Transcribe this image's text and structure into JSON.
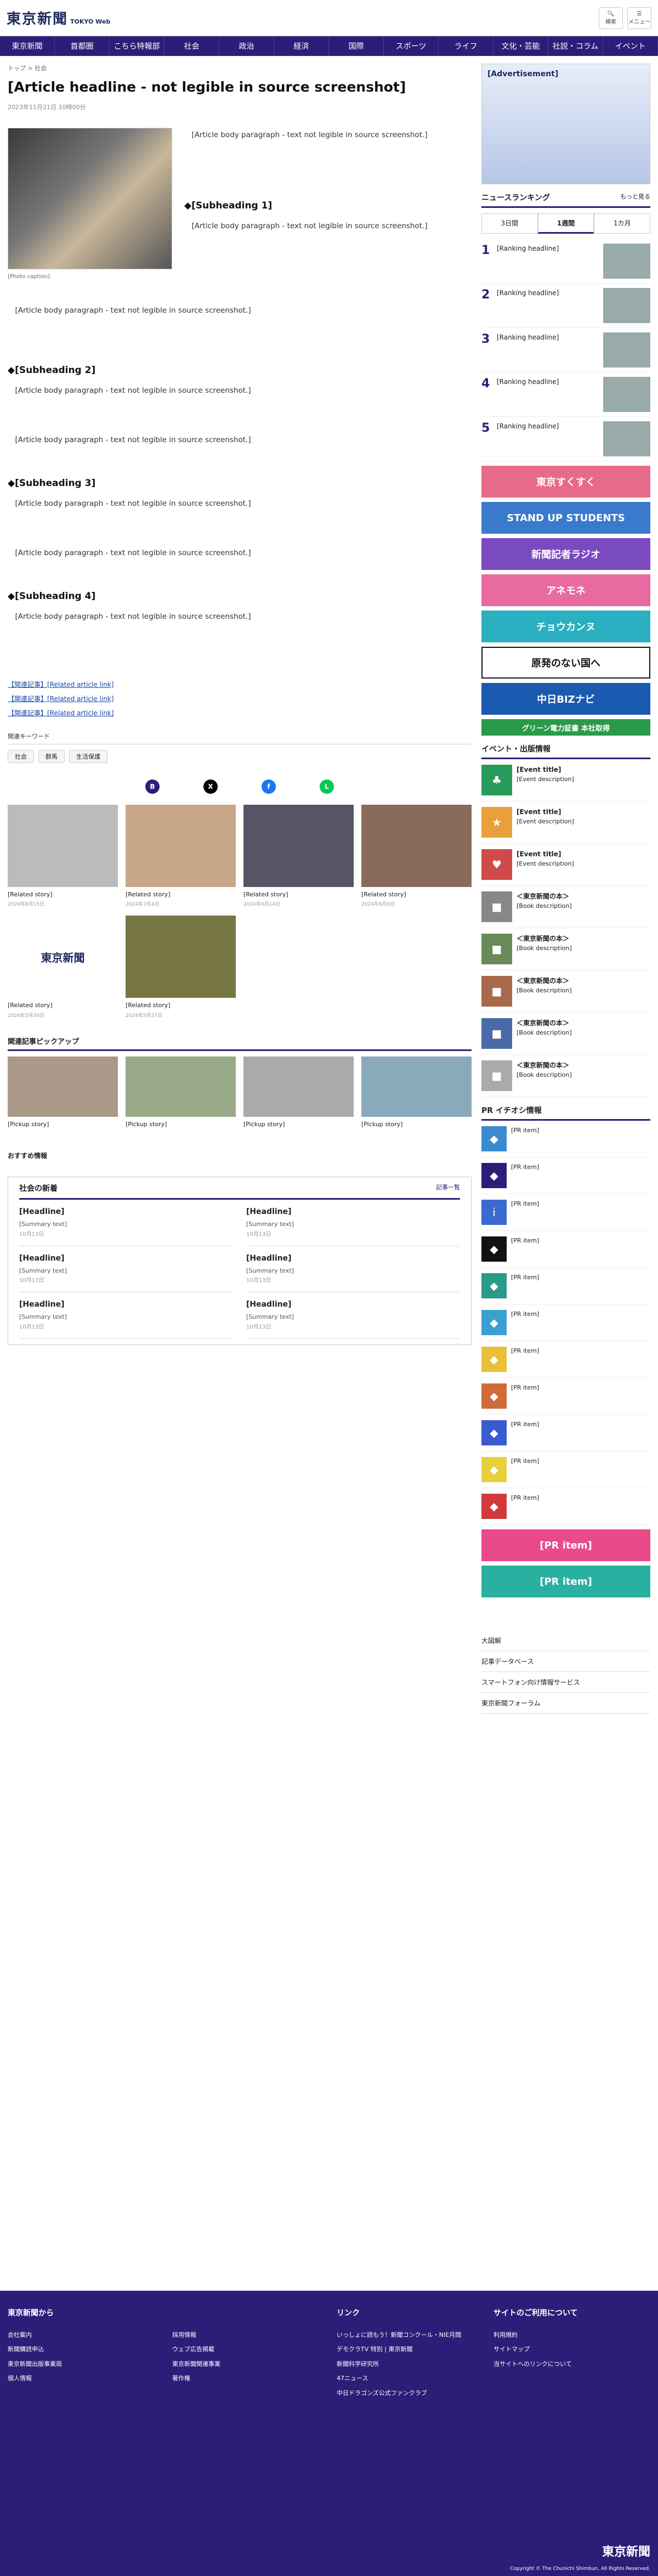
{
  "header": {
    "logo": "東京新聞",
    "logo_sub": "TOKYO Web",
    "btn1": "検索",
    "btn2": "メニュー"
  },
  "nav": [
    "東京新聞",
    "首都圏",
    "こちら特報部",
    "社会",
    "政治",
    "経済",
    "国際",
    "スポーツ",
    "ライフ",
    "文化・芸能",
    "社説・コラム",
    "イベント"
  ],
  "crumb": "トップ > 社会",
  "article": {
    "title": "[Article headline - not legible in source screenshot]",
    "date": "2023年11月21日 10時00分",
    "caption": "[Photo caption]",
    "p1": "[Article body paragraph - text not legible in source screenshot.]",
    "h1": "◆[Subheading 1]",
    "p2": "[Article body paragraph - text not legible in source screenshot.]",
    "p3": "[Article body paragraph - text not legible in source screenshot.]",
    "h2": "◆[Subheading 2]",
    "p4": "[Article body paragraph - text not legible in source screenshot.]",
    "p5": "[Article body paragraph - text not legible in source screenshot.]",
    "h3": "◆[Subheading 3]",
    "p6": "[Article body paragraph - text not legible in source screenshot.]",
    "p7": "[Article body paragraph - text not legible in source screenshot.]",
    "h4": "◆[Subheading 4]",
    "p8": "[Article body paragraph - text not legible in source screenshot.]",
    "rel1": "【関連記事】[Related article link]",
    "rel2": "【関連記事】[Related article link]",
    "rel3": "【関連記事】[Related article link]"
  },
  "keywords": {
    "label": "関連キーワード",
    "tags": [
      "社会",
      "群馬",
      "生活保護"
    ]
  },
  "related_cards": [
    {
      "t": "[Related story]",
      "d": "2024年8月15日"
    },
    {
      "t": "[Related story]",
      "d": "2024年7月4日"
    },
    {
      "t": "[Related story]",
      "d": "2024年6月14日"
    },
    {
      "t": "[Related story]",
      "d": "2024年6月6日"
    },
    {
      "t": "[Related story]",
      "d": "2024年5月30日"
    },
    {
      "t": "[Related story]",
      "d": "2024年5月27日"
    }
  ],
  "pickup": {
    "title": "関連記事ピックアップ",
    "cards": [
      "[Pickup story]",
      "[Pickup story]",
      "[Pickup story]",
      "[Pickup story]"
    ]
  },
  "reco": "おすすめ情報",
  "social": {
    "title": "社会の新着",
    "more": "記事一覧",
    "items": [
      {
        "t": "[Headline]",
        "p": "[Summary text]",
        "d": "10月13日"
      },
      {
        "t": "[Headline]",
        "p": "[Summary text]",
        "d": "10月13日"
      },
      {
        "t": "[Headline]",
        "p": "[Summary text]",
        "d": "10月13日"
      },
      {
        "t": "[Headline]",
        "p": "[Summary text]",
        "d": "10月13日"
      },
      {
        "t": "[Headline]",
        "p": "[Summary text]",
        "d": "10月13日"
      },
      {
        "t": "[Headline]",
        "p": "[Summary text]",
        "d": "10月13日"
      }
    ]
  },
  "side": {
    "ad": "[Advertisement]",
    "ranking": {
      "title": "ニュースランキング",
      "more": "もっと見る",
      "tabs": [
        "3日間",
        "1週間",
        "1カ月"
      ],
      "items": [
        {
          "no": "1",
          "t": "[Ranking headline]"
        },
        {
          "no": "2",
          "t": "[Ranking headline]"
        },
        {
          "no": "3",
          "t": "[Ranking headline]"
        },
        {
          "no": "4",
          "t": "[Ranking headline]"
        },
        {
          "no": "5",
          "t": "[Ranking headline]"
        }
      ]
    },
    "banners": [
      "東京すくすく",
      "STAND UP STUDENTS",
      "新聞記者ラジオ",
      "アネモネ",
      "チョウカンヌ",
      "原発のない国へ",
      "中日BIZナビ",
      "グリーン電力証書 本社取得"
    ],
    "events_title": "イベント・出版情報",
    "events": [
      {
        "b": "[Event title]",
        "t": "[Event description]"
      },
      {
        "b": "[Event title]",
        "t": "[Event description]"
      },
      {
        "b": "[Event title]",
        "t": "[Event description]"
      },
      {
        "b": "＜東京新聞の本＞",
        "t": "[Book description]"
      },
      {
        "b": "＜東京新聞の本＞",
        "t": "[Book description]"
      },
      {
        "b": "＜東京新聞の本＞",
        "t": "[Book description]"
      },
      {
        "b": "＜東京新聞の本＞",
        "t": "[Book description]"
      },
      {
        "b": "＜東京新聞の本＞",
        "t": "[Book description]"
      }
    ],
    "pr_title": "PR イチオシ情報",
    "pr": [
      "[PR item]",
      "[PR item]",
      "[PR item]",
      "[PR item]",
      "[PR item]",
      "[PR item]",
      "[PR item]",
      "[PR item]",
      "[PR item]",
      "[PR item]",
      "[PR item]",
      "[PR item]",
      "[PR item]"
    ],
    "links": [
      "大図解",
      "記事データベース",
      "スマートフォン向け情報サービス",
      "東京新聞フォーラム"
    ]
  },
  "footer": {
    "col1": {
      "h": "東京新聞から",
      "items": [
        "会社案内",
        "採用情報",
        "新聞購読申込",
        "ウェブ広告掲載",
        "東京新聞出版事業局",
        "東京新聞関連事業",
        "個人情報",
        "著作権"
      ]
    },
    "col2": {
      "h": "リンク",
      "items": [
        "いっしょに読もう！新聞コンクール・NIE月間",
        "デモクラTV 特別 | 東京新聞",
        "新聞科学研究所",
        "47ニュース",
        "中日ドラゴンズ公式ファンクラブ"
      ]
    },
    "col3": {
      "h": "サイトのご利用について",
      "items": [
        "利用規約",
        "サイトマップ",
        "当サイトへのリンクについて"
      ]
    },
    "copy": "Copyright © The Chunichi Shimbun, All Rights Reserved."
  }
}
